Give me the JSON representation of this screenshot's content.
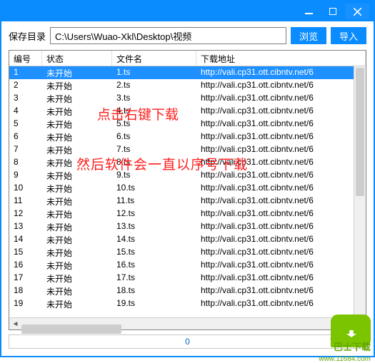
{
  "toolbar": {
    "save_dir_label": "保存目录",
    "path_value": "C:\\Users\\Wuao-Xkl\\Desktop\\视频",
    "browse_label": "浏览",
    "import_label": "导入"
  },
  "columns": {
    "num": "编号",
    "status": "状态",
    "file": "文件名",
    "url": "下载地址"
  },
  "rows": [
    {
      "num": "1",
      "status": "未开始",
      "file": "1.ts",
      "url": "http://vali.cp31.ott.cibntv.net/6"
    },
    {
      "num": "2",
      "status": "未开始",
      "file": "2.ts",
      "url": "http://vali.cp31.ott.cibntv.net/6"
    },
    {
      "num": "3",
      "status": "未开始",
      "file": "3.ts",
      "url": "http://vali.cp31.ott.cibntv.net/6"
    },
    {
      "num": "4",
      "status": "未开始",
      "file": "4.ts",
      "url": "http://vali.cp31.ott.cibntv.net/6"
    },
    {
      "num": "5",
      "status": "未开始",
      "file": "5.ts",
      "url": "http://vali.cp31.ott.cibntv.net/6"
    },
    {
      "num": "6",
      "status": "未开始",
      "file": "6.ts",
      "url": "http://vali.cp31.ott.cibntv.net/6"
    },
    {
      "num": "7",
      "status": "未开始",
      "file": "7.ts",
      "url": "http://vali.cp31.ott.cibntv.net/6"
    },
    {
      "num": "8",
      "status": "未开始",
      "file": "8.ts",
      "url": "http://vali.cp31.ott.cibntv.net/6"
    },
    {
      "num": "9",
      "status": "未开始",
      "file": "9.ts",
      "url": "http://vali.cp31.ott.cibntv.net/6"
    },
    {
      "num": "10",
      "status": "未开始",
      "file": "10.ts",
      "url": "http://vali.cp31.ott.cibntv.net/6"
    },
    {
      "num": "11",
      "status": "未开始",
      "file": "11.ts",
      "url": "http://vali.cp31.ott.cibntv.net/6"
    },
    {
      "num": "12",
      "status": "未开始",
      "file": "12.ts",
      "url": "http://vali.cp31.ott.cibntv.net/6"
    },
    {
      "num": "13",
      "status": "未开始",
      "file": "13.ts",
      "url": "http://vali.cp31.ott.cibntv.net/6"
    },
    {
      "num": "14",
      "status": "未开始",
      "file": "14.ts",
      "url": "http://vali.cp31.ott.cibntv.net/6"
    },
    {
      "num": "15",
      "status": "未开始",
      "file": "15.ts",
      "url": "http://vali.cp31.ott.cibntv.net/6"
    },
    {
      "num": "16",
      "status": "未开始",
      "file": "16.ts",
      "url": "http://vali.cp31.ott.cibntv.net/6"
    },
    {
      "num": "17",
      "status": "未开始",
      "file": "17.ts",
      "url": "http://vali.cp31.ott.cibntv.net/6"
    },
    {
      "num": "18",
      "status": "未开始",
      "file": "18.ts",
      "url": "http://vali.cp31.ott.cibntv.net/6"
    },
    {
      "num": "19",
      "status": "未开始",
      "file": "19.ts",
      "url": "http://vali.cp31.ott.cibntv.net/6"
    }
  ],
  "status_value": "0",
  "annotations": {
    "line1": "点击右键下载",
    "line2": "然后软件会一直以序号下载"
  },
  "hscroll": {
    "left_arrow": "◄",
    "right_arrow": "►"
  },
  "watermark": {
    "brand": "巴士下载",
    "url": "www.11684.com"
  }
}
